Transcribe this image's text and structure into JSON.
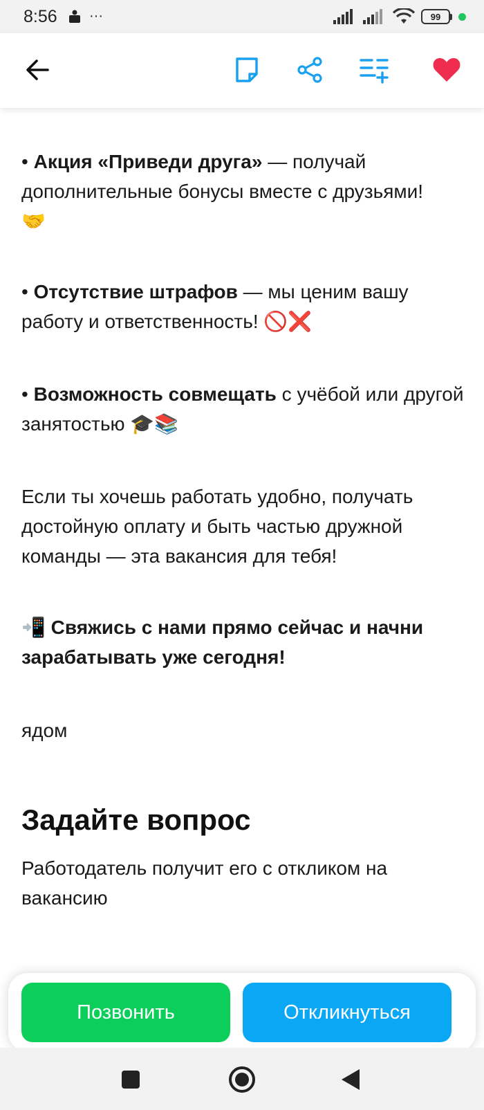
{
  "status": {
    "time": "8:56",
    "extra": "···",
    "battery": "99"
  },
  "appbar": {
    "icons": [
      "back-arrow-icon",
      "note-icon",
      "share-icon",
      "add-to-list-icon",
      "heart-icon"
    ],
    "accent": "#1aa0f0",
    "favorite_color": "#ef2e4f"
  },
  "content": {
    "promo": {
      "bullet": "•",
      "bold": "Акция «Приведи друга»",
      "rest": " — получай дополнительные бонусы вместе с друзьями!",
      "emoji": "🤝"
    },
    "no_fines": {
      "bullet": "•",
      "bold": "Отсутствие штрафов",
      "rest": " — мы ценим вашу работу и ответственность!",
      "emoji": "🚫❌"
    },
    "combine": {
      "bullet": "•",
      "bold": "Возможность совмещать",
      "rest": " с учёбой или другой занятостью",
      "emoji": "🎓📚"
    },
    "closing": "Если ты хочешь работать удобно, получать достойную оплату и быть частью дружной команды — эта вакансия для тебя!",
    "cta": {
      "emoji": "📲",
      "text": "Свяжись с нами прямо сейчас и начни зарабатывать уже сегодня!"
    },
    "tail": "ядом"
  },
  "question": {
    "title": "Задайте вопрос",
    "subtitle": "Работодатель получит его с откликом на вакансию"
  },
  "actions": {
    "call_label": "Позвонить",
    "apply_label": "Откликнуться",
    "call_color": "#0ccf5b",
    "apply_color": "#0aa7f5"
  },
  "navbar": {
    "icons": [
      "recents-square-icon",
      "home-circle-icon",
      "back-triangle-icon"
    ]
  }
}
